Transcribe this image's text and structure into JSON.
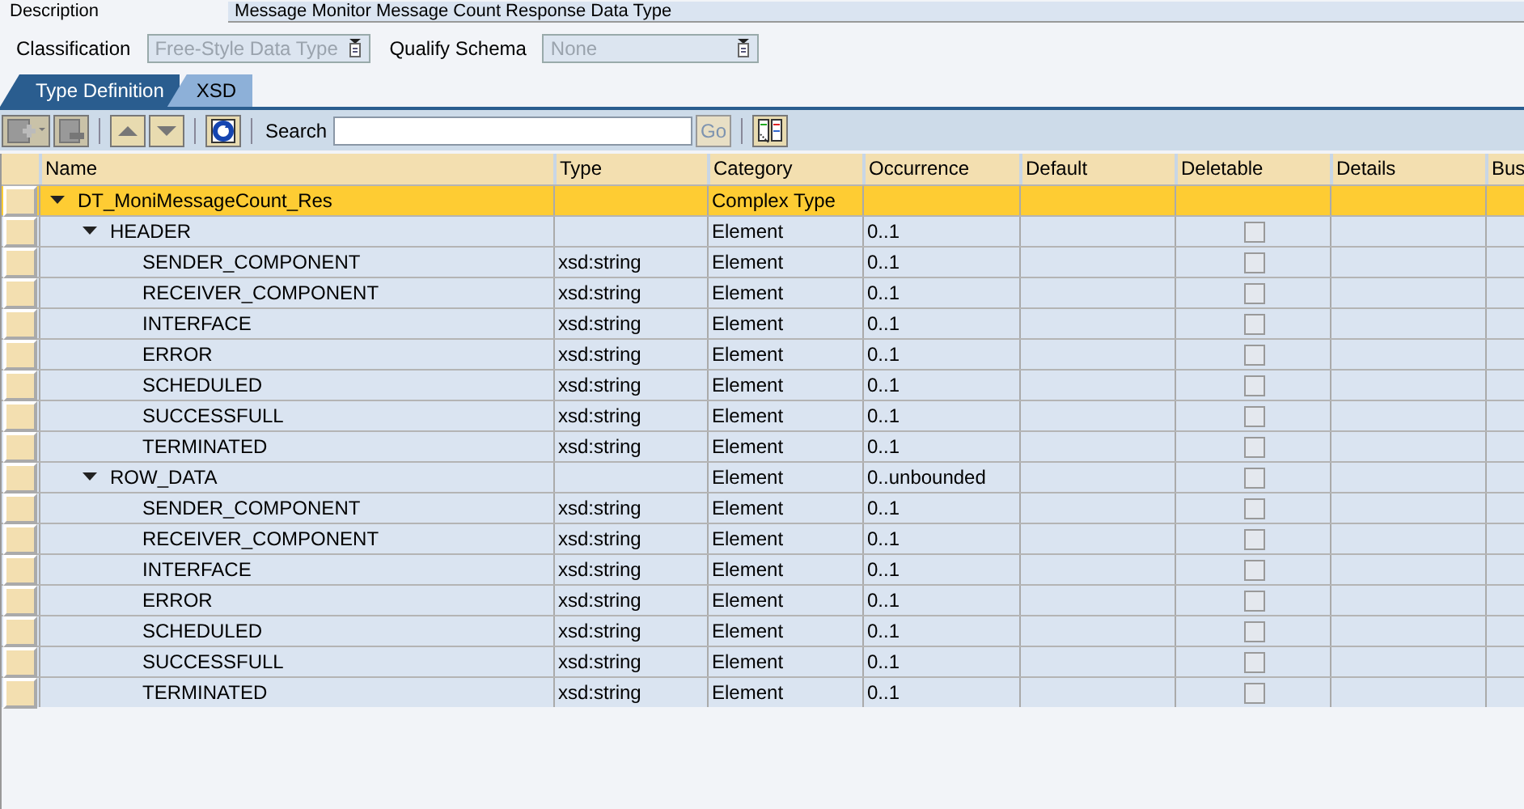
{
  "description": {
    "label": "Description",
    "value": "Message Monitor Message Count Response Data Type"
  },
  "classification": {
    "label": "Classification",
    "value": "Free-Style Data Type",
    "disabled": true
  },
  "qualify_schema": {
    "label": "Qualify Schema",
    "value": "None",
    "disabled": true
  },
  "tabs": [
    {
      "label": "Type Definition",
      "selected": true
    },
    {
      "label": "XSD",
      "selected": false
    }
  ],
  "toolbar": {
    "search_label": "Search",
    "go_label": "Go"
  },
  "table": {
    "columns": [
      "Name",
      "Type",
      "Category",
      "Occurrence",
      "Default",
      "Deletable",
      "Details",
      "Bus"
    ],
    "rows": [
      {
        "name": "DT_MoniMessageCount_Res",
        "category": "Complex Type",
        "selected": true,
        "expanded": true,
        "children": [
          {
            "name": "HEADER",
            "category": "Element",
            "occurrence": "0..1",
            "deletable": false,
            "selected": false,
            "expanded": true,
            "children": [
              {
                "name": "SENDER_COMPONENT",
                "type": "xsd:string",
                "category": "Element",
                "occurrence": "0..1",
                "deletable": false,
                "selected": false
              },
              {
                "name": "RECEIVER_COMPONENT",
                "type": "xsd:string",
                "category": "Element",
                "occurrence": "0..1",
                "deletable": false,
                "selected": false
              },
              {
                "name": "INTERFACE",
                "type": "xsd:string",
                "category": "Element",
                "occurrence": "0..1",
                "deletable": false,
                "selected": false
              },
              {
                "name": "ERROR",
                "type": "xsd:string",
                "category": "Element",
                "occurrence": "0..1",
                "deletable": false,
                "selected": false
              },
              {
                "name": "SCHEDULED",
                "type": "xsd:string",
                "category": "Element",
                "occurrence": "0..1",
                "deletable": false,
                "selected": false
              },
              {
                "name": "SUCCESSFULL",
                "type": "xsd:string",
                "category": "Element",
                "occurrence": "0..1",
                "deletable": false,
                "selected": false
              },
              {
                "name": "TERMINATED",
                "type": "xsd:string",
                "category": "Element",
                "occurrence": "0..1",
                "deletable": false,
                "selected": false
              }
            ]
          },
          {
            "name": "ROW_DATA",
            "category": "Element",
            "occurrence": "0..unbounded",
            "deletable": false,
            "selected": false,
            "expanded": true,
            "children": [
              {
                "name": "SENDER_COMPONENT",
                "type": "xsd:string",
                "category": "Element",
                "occurrence": "0..1",
                "deletable": false,
                "selected": false
              },
              {
                "name": "RECEIVER_COMPONENT",
                "type": "xsd:string",
                "category": "Element",
                "occurrence": "0..1",
                "deletable": false,
                "selected": false
              },
              {
                "name": "INTERFACE",
                "type": "xsd:string",
                "category": "Element",
                "occurrence": "0..1",
                "deletable": false,
                "selected": false
              },
              {
                "name": "ERROR",
                "type": "xsd:string",
                "category": "Element",
                "occurrence": "0..1",
                "deletable": false,
                "selected": false
              },
              {
                "name": "SCHEDULED",
                "type": "xsd:string",
                "category": "Element",
                "occurrence": "0..1",
                "deletable": false,
                "selected": false
              },
              {
                "name": "SUCCESSFULL",
                "type": "xsd:string",
                "category": "Element",
                "occurrence": "0..1",
                "deletable": false,
                "selected": false
              },
              {
                "name": "TERMINATED",
                "type": "xsd:string",
                "category": "Element",
                "occurrence": "0..1",
                "deletable": false,
                "selected": false
              }
            ]
          }
        ]
      }
    ]
  }
}
